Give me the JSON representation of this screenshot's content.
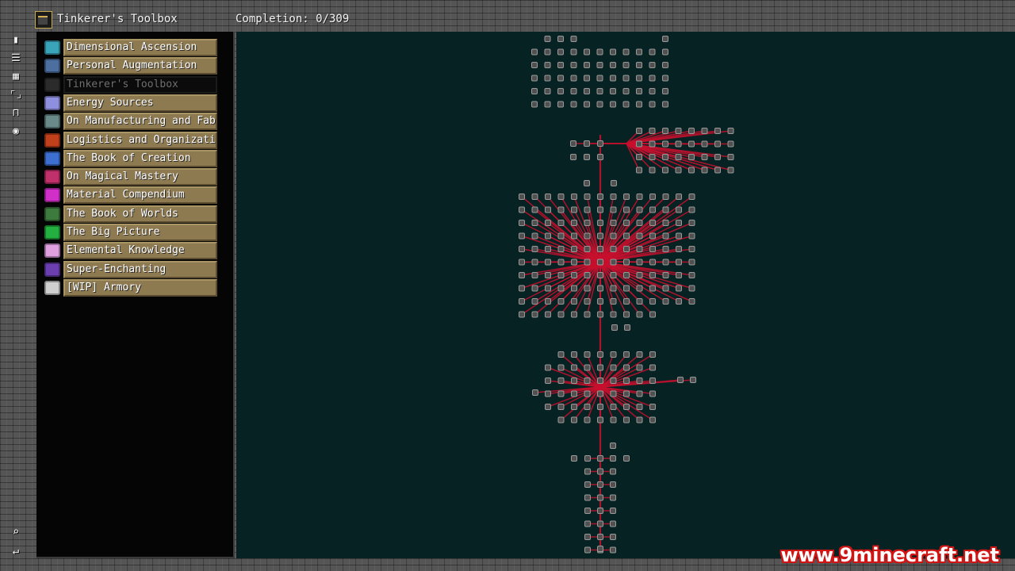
{
  "header": {
    "book_title": "Tinkerer's Toolbox",
    "completion": "Completion: 0/309"
  },
  "toolbar": {
    "tools": [
      {
        "name": "book-icon",
        "glyph": "▮"
      },
      {
        "name": "list-icon",
        "glyph": "☰"
      },
      {
        "name": "map-icon",
        "glyph": "▦"
      },
      {
        "name": "expand-icon",
        "glyph": "⌜⌟"
      },
      {
        "name": "lock-icon",
        "glyph": "⊓"
      },
      {
        "name": "eye-icon",
        "glyph": "◉"
      }
    ],
    "bottom": [
      {
        "name": "search-icon",
        "glyph": "⌕"
      },
      {
        "name": "return-icon",
        "glyph": "↵"
      }
    ]
  },
  "chapters": [
    {
      "label": "Dimensional Ascension",
      "icon": "dimensional-icon",
      "color": "#3aa5b8",
      "active": false
    },
    {
      "label": "Personal Augmentation",
      "icon": "augmentation-icon",
      "color": "#4d6fa0",
      "active": false
    },
    {
      "label": "Tinkerer's Toolbox",
      "icon": "toolbox-icon",
      "color": "#2b2b2b",
      "active": true
    },
    {
      "label": "Energy Sources",
      "icon": "energy-icon",
      "color": "#8f8fe0",
      "active": false
    },
    {
      "label": "On Manufacturing and Fab",
      "icon": "manufacturing-icon",
      "color": "#6a8a8a",
      "active": false
    },
    {
      "label": "Logistics and Organization",
      "icon": "logistics-icon",
      "color": "#c0401b",
      "active": false
    },
    {
      "label": "The Book of Creation",
      "icon": "creation-icon",
      "color": "#3c6fd0",
      "active": false
    },
    {
      "label": "On Magical Mastery",
      "icon": "magic-icon",
      "color": "#c0306a",
      "active": false
    },
    {
      "label": "Material Compendium",
      "icon": "material-icon",
      "color": "#d030c8",
      "active": false
    },
    {
      "label": "The Book of Worlds",
      "icon": "worlds-icon",
      "color": "#3d7a3d",
      "active": false
    },
    {
      "label": "The Big Picture",
      "icon": "picture-icon",
      "color": "#24b040",
      "active": false
    },
    {
      "label": "Elemental Knowledge",
      "icon": "elemental-icon",
      "color": "#e0a0e0",
      "active": false
    },
    {
      "label": "Super-Enchanting",
      "icon": "enchanting-icon",
      "color": "#6b3fb0",
      "active": false
    },
    {
      "label": "[WIP] Armory",
      "icon": "armory-icon",
      "color": "#cfcfcf",
      "active": false
    }
  ],
  "colors": {
    "quest_background": "#072222",
    "line": "#c8102e",
    "node_fill": "#505050",
    "node_border": "#9a9a9a"
  },
  "watermark": "www.9minecraft.net"
}
